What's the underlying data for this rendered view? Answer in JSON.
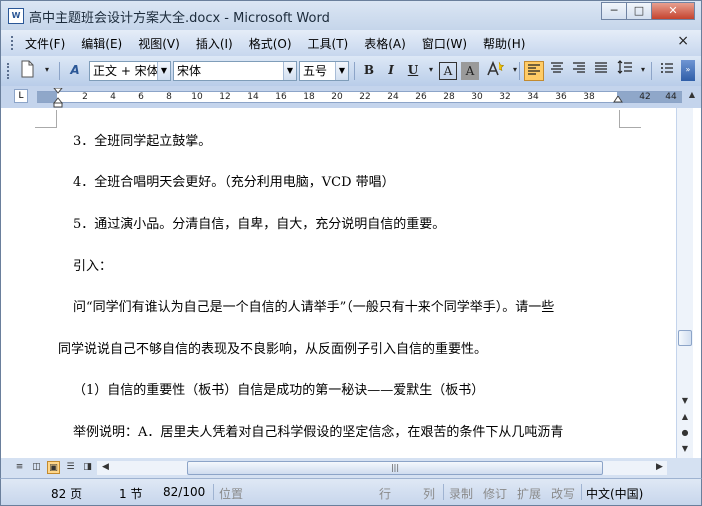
{
  "window": {
    "title": "高中主题班会设计方案大全.docx - Microsoft Word",
    "app_icon": "word-doc-icon",
    "minimize": "─",
    "maximize": "□",
    "close": "✕"
  },
  "menu": {
    "items": [
      "文件(F)",
      "编辑(E)",
      "视图(V)",
      "插入(I)",
      "格式(O)",
      "工具(T)",
      "表格(A)",
      "窗口(W)",
      "帮助(H)"
    ],
    "close_doc": "×"
  },
  "toolbar": {
    "style_value": "正文 + 宋体",
    "font_value": "宋体",
    "size_value": "五号",
    "bold": "B",
    "italic": "I",
    "underline": "U",
    "char_border": "A",
    "char_shading": "A",
    "new_doc_icon": "new-document-icon",
    "styles_icon": "styles-icon"
  },
  "ruler": {
    "ticks": [
      "2",
      "4",
      "6",
      "8",
      "10",
      "12",
      "14",
      "16",
      "18",
      "20",
      "22",
      "24",
      "26",
      "28",
      "30",
      "32",
      "34",
      "36",
      "38",
      "42",
      "44"
    ],
    "tab_selector": "L"
  },
  "document": {
    "paragraphs": [
      "3．全班同学起立鼓掌。",
      "4．全班合唱明天会更好。（充分利用电脑，VCD 带唱）",
      "5．通过演小品。分清自信，自卑，自大，充分说明自信的重要。",
      "引入：",
      "问“同学们有谁认为自己是一个自信的人请举手”（一般只有十来个同学举手）。请一些",
      "同学说说自己不够自信的表现及不良影响，从反面例子引入自信的重要性。",
      "（1）自信的重要性（板书）自信是成功的第一秘诀——爱默生（板书）",
      "举例说明：A．居里夫人凭着对自己科学假设的坚定信念，在艰苦的条件下从几吨沥青"
    ]
  },
  "statusbar": {
    "page": "82 页",
    "section": "1 节",
    "page_of": "82/100",
    "position": "位置",
    "line": "行",
    "column": "列",
    "record": "录制",
    "revise": "修订",
    "extend": "扩展",
    "overtype": "改写",
    "language": "中文(中国)"
  },
  "colors": {
    "chrome": "#c7d6ec",
    "active_toggle": "#ffcc66"
  }
}
